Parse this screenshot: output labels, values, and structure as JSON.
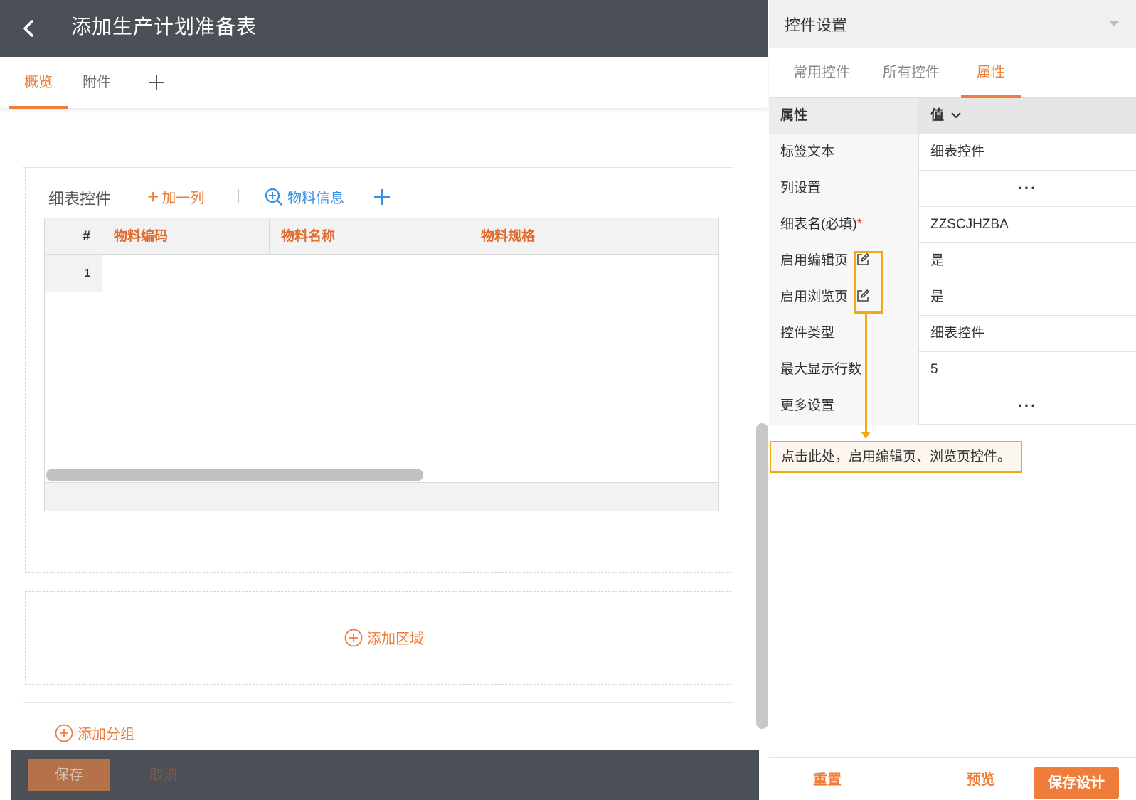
{
  "header": {
    "title": "添加生产计划准备表"
  },
  "tabs": [
    {
      "label": "概览"
    },
    {
      "label": "附件"
    }
  ],
  "subtable": {
    "label": "细表控件",
    "add_column_label": "加一列",
    "material_info_label": "物料信息",
    "columns": [
      "#",
      "物料编码",
      "物料名称",
      "物料规格"
    ],
    "rows": [
      {
        "num": "1"
      }
    ]
  },
  "add_region_label": "添加区域",
  "add_group_label": "添加分组",
  "bottom_bar": {
    "save_label": "保存",
    "cancel_label": "取消"
  },
  "panel": {
    "title": "控件设置",
    "tabs": [
      "常用控件",
      "所有控件",
      "属性"
    ],
    "header": {
      "key": "属性",
      "value": "值"
    },
    "properties": [
      {
        "key": "标签文本",
        "value": "细表控件"
      },
      {
        "key": "列设置",
        "value": "···"
      },
      {
        "key": "细表名(必填)",
        "required_mark": "*",
        "value": "ZZSCJHZBA"
      },
      {
        "key": "启用编辑页",
        "value": "是"
      },
      {
        "key": "启用浏览页",
        "value": "是"
      },
      {
        "key": "控件类型",
        "value": "细表控件"
      },
      {
        "key": "最大显示行数",
        "value": "5"
      },
      {
        "key": "更多设置",
        "value": "···"
      }
    ],
    "callout": "点击此处，启用编辑页、浏览页控件。",
    "footer": {
      "reset_label": "重置",
      "preview_label": "预览",
      "save_design_label": "保存设计"
    }
  },
  "colors": {
    "accent": "#f07c3a",
    "link_blue": "#3a8fdc",
    "dark_bar": "#4b5057",
    "callout_border": "#f0a913"
  }
}
